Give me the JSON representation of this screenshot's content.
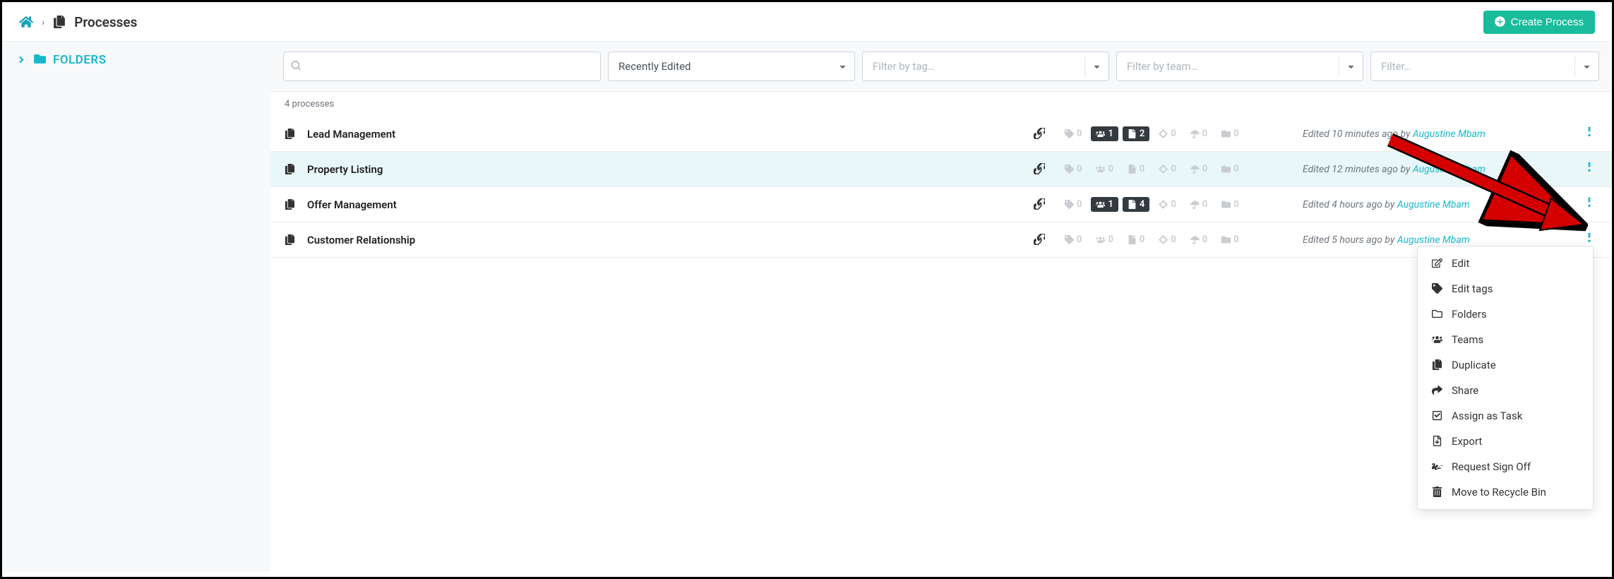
{
  "header": {
    "title": "Processes",
    "create_button": "Create Process"
  },
  "sidebar": {
    "folders_label": "FOLDERS"
  },
  "filters": {
    "search_placeholder": "",
    "sort_label": "Recently Edited",
    "tag_placeholder": "Filter by tag…",
    "team_placeholder": "Filter by team…",
    "filter_placeholder": "Filter…"
  },
  "count_text": "4 processes",
  "processes": [
    {
      "name": "Lead Management",
      "badges": {
        "tags": "0",
        "teams": "1",
        "docs": "2",
        "diamond": "0",
        "umbrella": "0",
        "folder": "0"
      },
      "teams_active": true,
      "docs_active": true,
      "edited_prefix": "Edited 10 minutes ago by ",
      "edited_by": "Augustine Mbam"
    },
    {
      "name": "Property Listing",
      "badges": {
        "tags": "0",
        "teams": "0",
        "docs": "0",
        "diamond": "0",
        "umbrella": "0",
        "folder": "0"
      },
      "teams_active": false,
      "docs_active": false,
      "edited_prefix": "Edited 12 minutes ago by ",
      "edited_by": "Augustine Mbam"
    },
    {
      "name": "Offer Management",
      "badges": {
        "tags": "0",
        "teams": "1",
        "docs": "4",
        "diamond": "0",
        "umbrella": "0",
        "folder": "0"
      },
      "teams_active": true,
      "docs_active": true,
      "edited_prefix": "Edited 4 hours ago by ",
      "edited_by": "Augustine Mbam"
    },
    {
      "name": "Customer Relationship",
      "badges": {
        "tags": "0",
        "teams": "0",
        "docs": "0",
        "diamond": "0",
        "umbrella": "0",
        "folder": "0"
      },
      "teams_active": false,
      "docs_active": false,
      "edited_prefix": "Edited 5 hours ago by ",
      "edited_by": "Augustine Mbam"
    }
  ],
  "dropdown": {
    "items": [
      {
        "icon": "edit",
        "label": "Edit"
      },
      {
        "icon": "tag",
        "label": "Edit tags"
      },
      {
        "icon": "folder",
        "label": "Folders"
      },
      {
        "icon": "users",
        "label": "Teams"
      },
      {
        "icon": "copy",
        "label": "Duplicate"
      },
      {
        "icon": "share",
        "label": "Share"
      },
      {
        "icon": "check",
        "label": "Assign as Task"
      },
      {
        "icon": "export",
        "label": "Export"
      },
      {
        "icon": "signoff",
        "label": "Request Sign Off"
      },
      {
        "icon": "trash",
        "label": "Move to Recycle Bin"
      }
    ]
  }
}
